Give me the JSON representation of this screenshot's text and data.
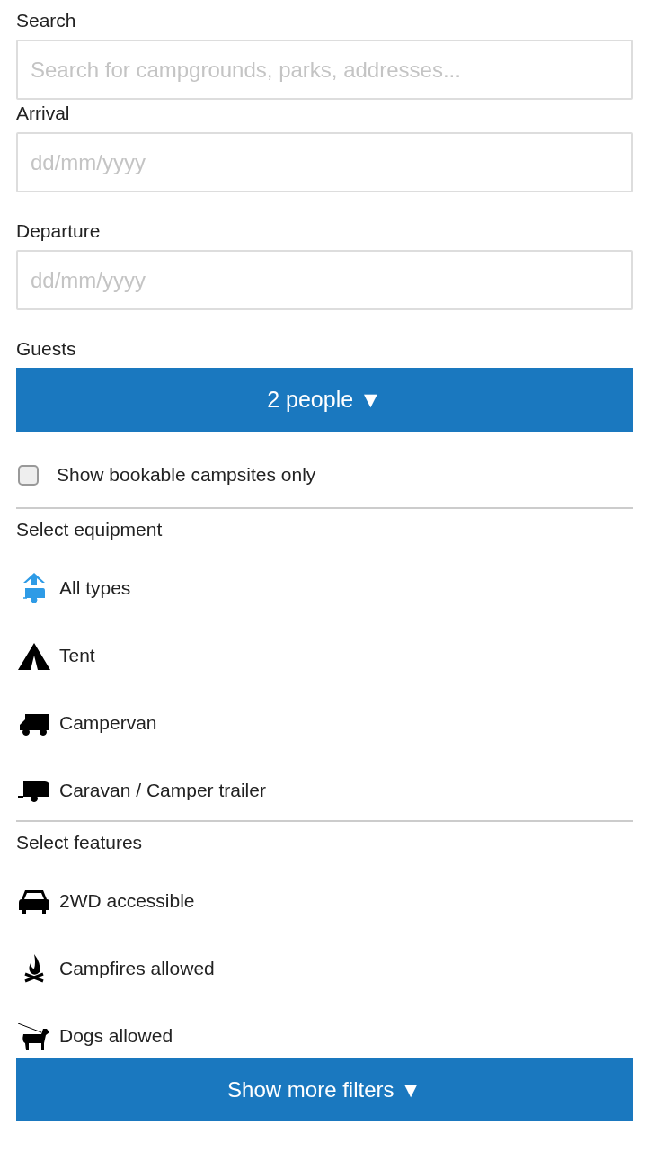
{
  "search": {
    "label": "Search",
    "placeholder": "Search for campgrounds, parks, addresses..."
  },
  "arrival": {
    "label": "Arrival",
    "placeholder": "dd/mm/yyyy"
  },
  "departure": {
    "label": "Departure",
    "placeholder": "dd/mm/yyyy"
  },
  "guests": {
    "label": "Guests",
    "button": "2 people ▼"
  },
  "bookable_only": {
    "label": "Show bookable campsites only",
    "checked": false
  },
  "equipment": {
    "title": "Select equipment",
    "items": [
      {
        "kind": "all",
        "label": "All types",
        "selected": true
      },
      {
        "kind": "tent",
        "label": "Tent",
        "selected": false
      },
      {
        "kind": "campervan",
        "label": "Campervan",
        "selected": false
      },
      {
        "kind": "caravan",
        "label": "Caravan / Camper trailer",
        "selected": false
      }
    ]
  },
  "features": {
    "title": "Select features",
    "items": [
      {
        "kind": "car",
        "label": "2WD accessible"
      },
      {
        "kind": "campfire",
        "label": "Campfires allowed"
      },
      {
        "kind": "dog",
        "label": "Dogs allowed"
      }
    ]
  },
  "more_filters_button": "Show more filters ▼"
}
